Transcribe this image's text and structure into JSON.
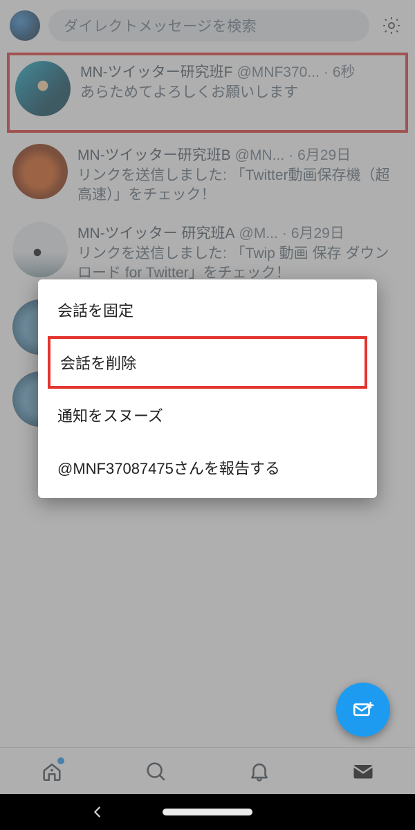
{
  "header": {
    "search_placeholder": "ダイレクトメッセージを検索"
  },
  "conversations": [
    {
      "name": "MN-ツイッター研究班F",
      "handle": "@MNF370...",
      "time": "6秒",
      "preview": "あらためてよろしくお願いします"
    },
    {
      "name": "MN-ツイッター研究班B",
      "handle": "@MN...",
      "time": "6月29日",
      "preview": "リンクを送信しました: 「Twitter動画保存機（超高速）」をチェック！"
    },
    {
      "name": "MN-ツイッター 研究班A",
      "handle": "@M...",
      "time": "6月29日",
      "preview": "リンクを送信しました: 「Twip 動画 保存 ダウンロード for Twitter」をチェック！"
    },
    {
      "name": "",
      "handle": "",
      "time": "",
      "preview": ""
    },
    {
      "name": "",
      "handle": "",
      "time": "",
      "preview": ""
    }
  ],
  "action_sheet": {
    "pin": "会話を固定",
    "delete": "会話を削除",
    "snooze": "通知をスヌーズ",
    "report": "@MNF37087475さんを報告する"
  }
}
